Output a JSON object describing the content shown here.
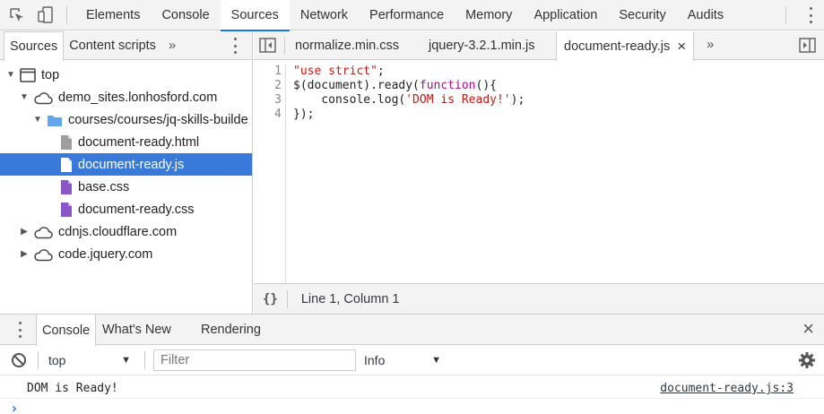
{
  "main_tabs": [
    "Elements",
    "Console",
    "Sources",
    "Network",
    "Performance",
    "Memory",
    "Application",
    "Security",
    "Audits"
  ],
  "active_main_tab": "Sources",
  "navigator": {
    "tabs": [
      "Sources",
      "Content scripts"
    ],
    "more": "»",
    "tree": [
      {
        "label": "top",
        "icon": "frame-icon",
        "depth": 0,
        "expanded": true
      },
      {
        "label": "demo_sites.lonhosford.com",
        "icon": "cloud-icon",
        "depth": 1,
        "expanded": true
      },
      {
        "label": "courses/courses/jq-skills-builde",
        "icon": "folder-icon",
        "depth": 2,
        "expanded": true
      },
      {
        "label": "document-ready.html",
        "icon": "file-html-icon",
        "depth": 3
      },
      {
        "label": "document-ready.js",
        "icon": "file-js-icon",
        "depth": 3,
        "selected": true
      },
      {
        "label": "base.css",
        "icon": "file-css-icon",
        "depth": 3
      },
      {
        "label": "document-ready.css",
        "icon": "file-css-icon",
        "depth": 3
      },
      {
        "label": "cdnjs.cloudflare.com",
        "icon": "cloud-icon",
        "depth": 1,
        "expanded": false
      },
      {
        "label": "code.jquery.com",
        "icon": "cloud-icon",
        "depth": 1,
        "expanded": false
      }
    ]
  },
  "editor": {
    "tabs": [
      "normalize.min.css",
      "jquery-3.2.1.min.js",
      "document-ready.js"
    ],
    "active_tab": "document-ready.js",
    "close_glyph": "×",
    "more": "»",
    "line_numbers": [
      "1",
      "2",
      "3",
      "4"
    ],
    "code_lines": [
      [
        {
          "t": "\"use strict\"",
          "c": "str"
        },
        {
          "t": ";",
          "c": ""
        }
      ],
      [
        {
          "t": "$(document).ready(",
          "c": ""
        },
        {
          "t": "function",
          "c": "kw"
        },
        {
          "t": "(){",
          "c": ""
        }
      ],
      [
        {
          "t": "    console.log(",
          "c": ""
        },
        {
          "t": "'DOM is Ready!'",
          "c": "str"
        },
        {
          "t": ");",
          "c": ""
        }
      ],
      [
        {
          "t": "});",
          "c": ""
        }
      ]
    ],
    "format_glyph": "{}",
    "status_text": "Line 1, Column 1"
  },
  "drawer": {
    "tabs": [
      "Console",
      "What's New",
      "Rendering"
    ],
    "active_tab": "Console",
    "close_glyph": "×",
    "context": "top",
    "filter_placeholder": "Filter",
    "level": "Info",
    "messages": [
      {
        "text": "DOM is Ready!",
        "source": "document-ready.js:3"
      }
    ],
    "prompt": "›"
  },
  "colors": {
    "accent": "#1a73e8",
    "selection": "#3879d9",
    "string": "#c41a16",
    "keyword": "#aa0d91",
    "link": "#303942"
  }
}
